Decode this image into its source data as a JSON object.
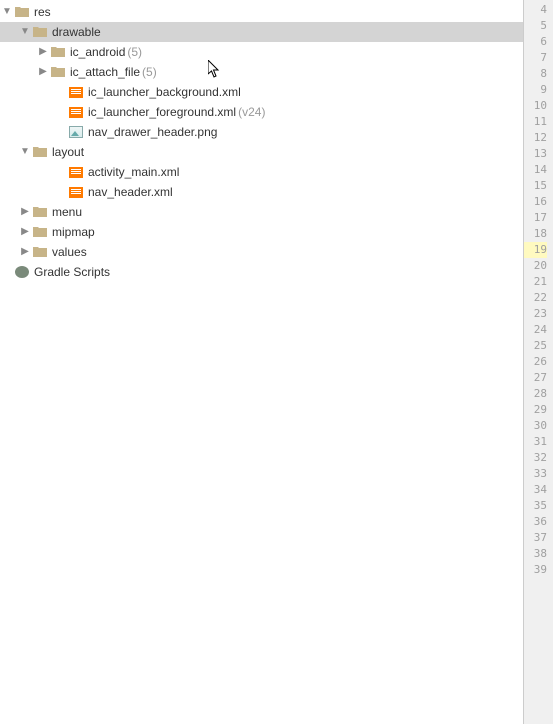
{
  "tree": {
    "res": "res",
    "drawable": "drawable",
    "ic_android": {
      "label": "ic_android",
      "count": "(5)"
    },
    "ic_attach_file": {
      "label": "ic_attach_file",
      "count": "(5)"
    },
    "launcher_bg": "ic_launcher_background.xml",
    "launcher_fg": {
      "label": "ic_launcher_foreground.xml",
      "qualifier": "(v24)"
    },
    "nav_drawer": "nav_drawer_header.png",
    "layout": "layout",
    "activity_main": "activity_main.xml",
    "nav_header": "nav_header.xml",
    "menu": "menu",
    "mipmap": "mipmap",
    "values": "values",
    "gradle": "Gradle Scripts"
  },
  "gutter": {
    "start": 4,
    "end": 39,
    "highlight": 19
  }
}
